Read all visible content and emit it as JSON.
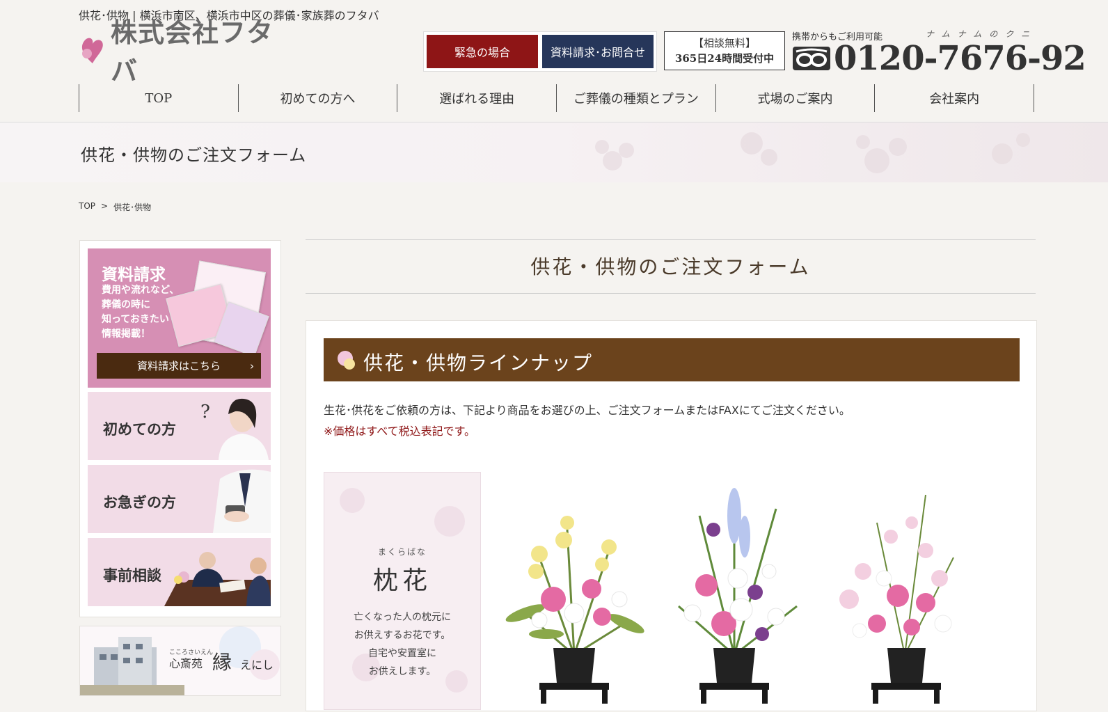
{
  "header": {
    "tagline": "供花･供物 | 横浜市南区、横浜市中区の葬儀･家族葬のフタバ",
    "logo_text": "株式会社フタバ",
    "emergency_label": "緊急の場合",
    "inquiry_label": "資料請求･お問合せ",
    "consult_line1": "【相談無料】",
    "consult_line2": "365日24時間受付中",
    "mobile_note": "携帯からもご利用可能",
    "phone_kana": "ナムナムのクニ",
    "phone": "0120-7676-92"
  },
  "nav": [
    "TOP",
    "初めての方へ",
    "選ばれる理由",
    "ご葬儀の種類とプラン",
    "式場のご案内",
    "会社案内"
  ],
  "page_band_title": "供花・供物のご注文フォーム",
  "breadcrumb": {
    "home": "TOP",
    "sep": ">",
    "current": "供花･供物"
  },
  "sidebar": {
    "request": {
      "title": "資料請求",
      "line1": "費用や流れなど、",
      "line2": "葬儀の時に",
      "line3": "知っておきたい",
      "line4": "情報掲載！",
      "cta": "資料請求はこちら"
    },
    "first_time": "初めての方",
    "urgent": "お急ぎの方",
    "pre_consult": "事前相談",
    "hall_ruby": "こころさいえん",
    "hall_name_a": "心斎苑",
    "hall_name_b": "縁",
    "hall_name_c": "えにし"
  },
  "main": {
    "title": "供花・供物のご注文フォーム",
    "lineup_title": "供花・供物ラインナップ",
    "description": "生花･供花をご依頼の方は、下記より商品をお選びの上、ご注文フォームまたはFAXにてご注文ください。",
    "note": "※価格はすべて税込表記です。",
    "card": {
      "ruby": "まくらばな",
      "name": "枕花",
      "desc1": "亡くなった人の枕元に",
      "desc2": "お供えするお花です。",
      "desc3": "自宅や安置室に",
      "desc4": "お供えします。"
    }
  },
  "colors": {
    "emergency": "#8e1516",
    "inquiry": "#26365a",
    "lineup_bar": "#6b431c",
    "note": "#8e1516",
    "pink": "#d68fb4"
  }
}
